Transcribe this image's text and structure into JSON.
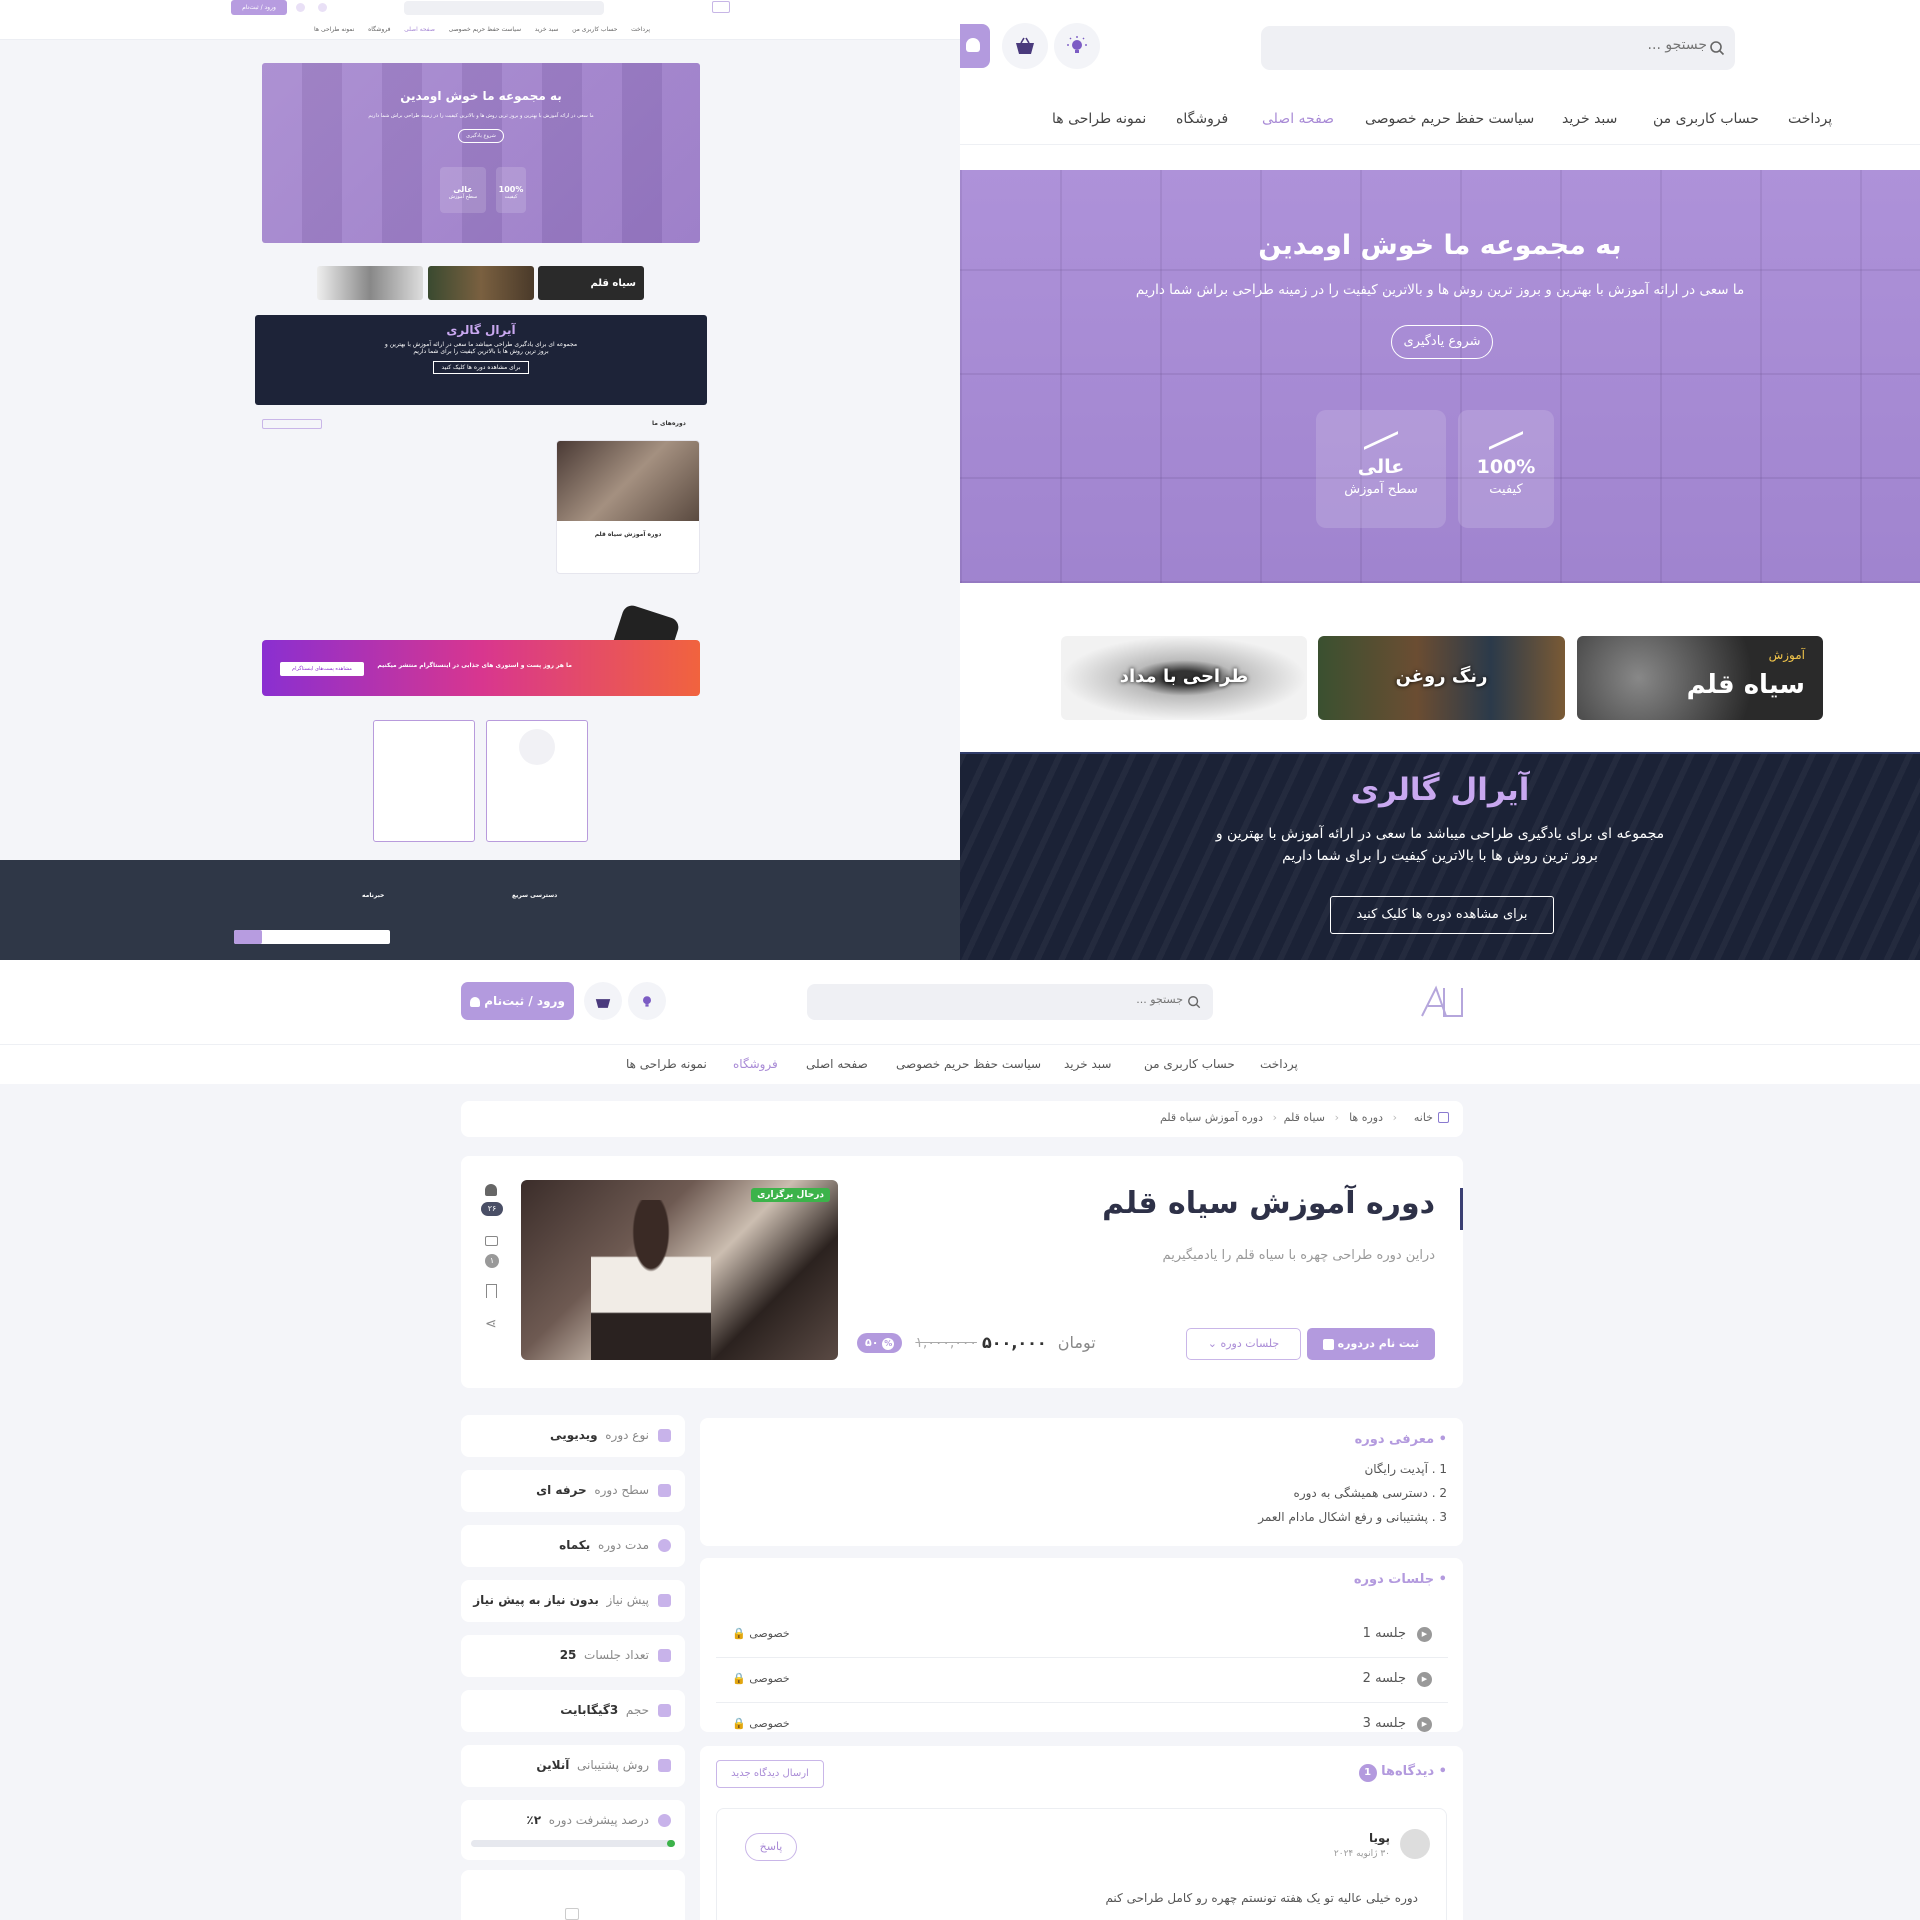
{
  "nav": {
    "items": [
      "پرداخت",
      "حساب کاربری من",
      "سبد خرید",
      "سیاست حفظ حریم خصوصی",
      "صفحه اصلی",
      "فروشگاه",
      "نمونه طراحی ها"
    ]
  },
  "search": {
    "placeholder": "جستجو ..."
  },
  "header": {
    "login_label": "ورود / ثبت‌نام"
  },
  "hero": {
    "title": "به مجموعه ما خوش اومدین",
    "subtitle": "ما سعی در ارائه آموزش با بهترین و بروز ترین روش ها و بالاترین کیفیت را در زمینه طراحی براش شما داریم",
    "cta": "شروع یادگیری",
    "stats": [
      {
        "value": "100%",
        "label": "کیفیت"
      },
      {
        "value": "عالی",
        "label": "سطح آموزش"
      }
    ]
  },
  "categories": [
    {
      "kicker": "آموزش",
      "title": "سیاه قلم"
    },
    {
      "kicker": "",
      "title": "رنگ روغن"
    },
    {
      "kicker": "",
      "title": "طراحی با مداد"
    }
  ],
  "gallery": {
    "title": "آیرال گالری",
    "text_line1": "مجموعه ای برای یادگیری طراحی میباشد ما سعی در ارائه آموزش با بهترین و",
    "text_line2": "بروز ترین روش ها با بالاترین کیفیت را برای شما داریم",
    "cta": "برای مشاهده دوره ها کلیک کنید"
  },
  "mini": {
    "courses_heading": "دوره‌های ما",
    "course_title": "دوره آموزش سیاه قلم",
    "instagram": "ما هر روز پست و استوری های جذابی در اینستاگرام منتشر میکنیم",
    "instagram_btn": "مشاهده پست‌های اینستاگرام",
    "footer_quick": "دسترسی سریع",
    "footer_news": "خبرنامه"
  },
  "breadcrumb": [
    "خانه",
    "دوره ها",
    "سیاه قلم",
    "دوره آموزش سیاه قلم"
  ],
  "course": {
    "title": "دوره آموزش سیاه قلم",
    "subtitle": "دراین دوره طراحی چهره با سیاه قلم را یادمیگیریم",
    "status_badge": "درحال برگزاری",
    "enroll_label": "ثبت نام دردوره",
    "sessions_label": "جلسات دوره",
    "old_price": "۱,۰۰۰,۰۰۰",
    "price": "۵۰۰,۰۰۰",
    "currency": "تومان",
    "discount": "۵۰",
    "students_count": "۲۶",
    "comments_count": "۱"
  },
  "intro": {
    "heading": "معرفی دوره",
    "items": [
      "1 . آپدیت رایگان",
      "2 . دسترسی همیشگی به دوره",
      "3 . پشتیبانی و رفع اشکال مادام العمر"
    ]
  },
  "sessions": {
    "heading": "جلسات دوره",
    "items": [
      {
        "name": "جلسه 1",
        "access": "خصوصی"
      },
      {
        "name": "جلسه 2",
        "access": "خصوصی"
      },
      {
        "name": "جلسه 3",
        "access": "خصوصی"
      }
    ]
  },
  "comments": {
    "heading": "دیدگاه‌ها",
    "count": "1",
    "new_label": "ارسال دیدگاه جدید",
    "items": [
      {
        "author": "پویا",
        "date": "۳۰ ژانویه ۲۰۲۴",
        "reply": "پاسخ",
        "text": "دوره خیلی عالیه تو یک هفته تونستم چهره رو کامل طراحی کنم"
      }
    ]
  },
  "info": [
    {
      "label": "نوع دوره",
      "value": "ویدیویی"
    },
    {
      "label": "سطح دوره",
      "value": "حرفه ای"
    },
    {
      "label": "مدت دوره",
      "value": "یکماه"
    },
    {
      "label": "پیش نیاز",
      "value": "بدون نیاز به پیش نیاز"
    },
    {
      "label": "تعداد جلسات",
      "value": "25"
    },
    {
      "label": "حجم",
      "value": "3گیگابایت"
    },
    {
      "label": "روش پشتیبانی",
      "value": "آنلاین"
    },
    {
      "label": "درصد پیشرفت دوره",
      "value": "۲٪"
    }
  ],
  "progress": {
    "fraction": 0.02
  },
  "colors": {
    "accent": "#a98bd6",
    "accent_dark": "#8f6fc9",
    "dark_navy": "#1b2236",
    "green": "#3cb34a"
  }
}
